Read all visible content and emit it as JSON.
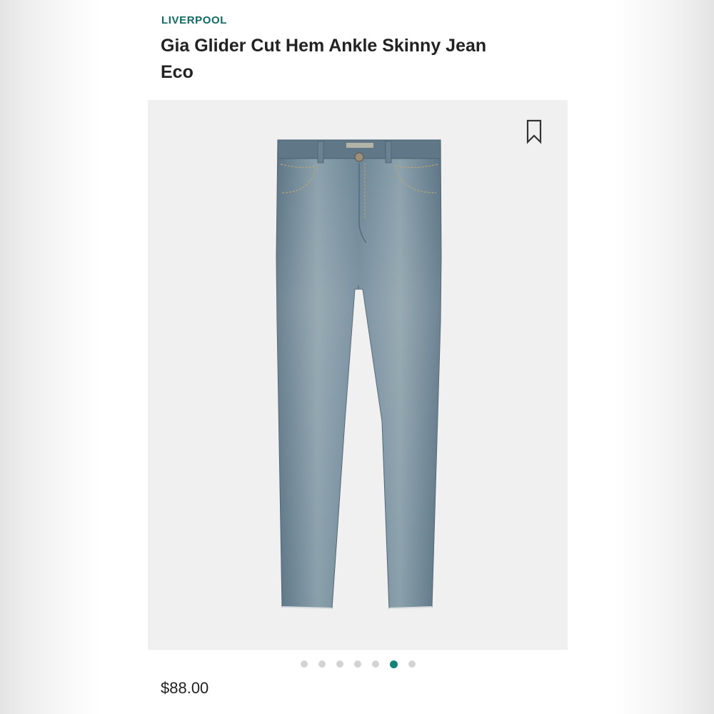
{
  "product": {
    "brand": "LIVERPOOL",
    "title": "Gia Glider Cut Hem Ankle Skinny Jean Eco",
    "price": "$88.00"
  },
  "icons": {
    "bookmark": "bookmark-icon"
  },
  "carousel": {
    "dots": [
      false,
      false,
      false,
      false,
      false,
      true,
      false
    ]
  },
  "colors": {
    "brand": "#0f6b63",
    "active_dot": "#13837a",
    "inactive_dot": "#d3d3d3",
    "denim": "#6e8798"
  }
}
